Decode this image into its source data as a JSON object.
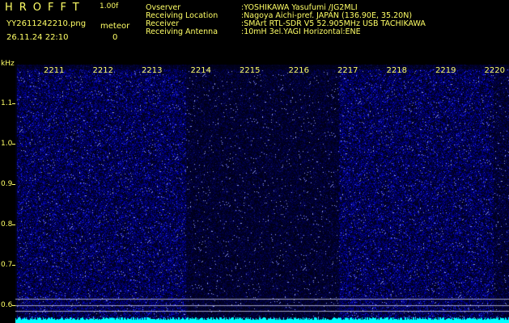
{
  "header": {
    "brand": "HROFFT",
    "version": "1.00f",
    "filename": "YY2611242210.png",
    "datetime": "26.11.24 22:10",
    "meteor_label": "meteor",
    "meteor_count": "0"
  },
  "info": [
    {
      "label": "Ovserver",
      "value": ":YOSHIKAWA Yasufumi /JG2MLI"
    },
    {
      "label": "Receiving Location",
      "value": ":Nagoya Aichi-pref. JAPAN (136.90E, 35.20N)"
    },
    {
      "label": "Receiver",
      "value": ":SMArt RTL-SDR V5 52.905MHz USB TACHIKAWA"
    },
    {
      "label": "Receiving Antenna",
      "value": ":10mH 3el.YAGI Horizontal:ENE"
    }
  ],
  "chart_data": {
    "type": "heatmap",
    "ylabel": "kHz",
    "y_ticks": [
      "1.1",
      "1.0",
      "0.9",
      "0.8",
      "0.7",
      "0.6"
    ],
    "x_ticks": [
      "2211",
      "2212",
      "2213",
      "2214",
      "2215",
      "2216",
      "2217",
      "2218",
      "2219",
      "2220"
    ],
    "colors": {
      "background": "#000000",
      "noise_low": "#000033",
      "noise_high": "#3030ff",
      "baseline": "#00ffff",
      "label": "#ffff66"
    }
  }
}
